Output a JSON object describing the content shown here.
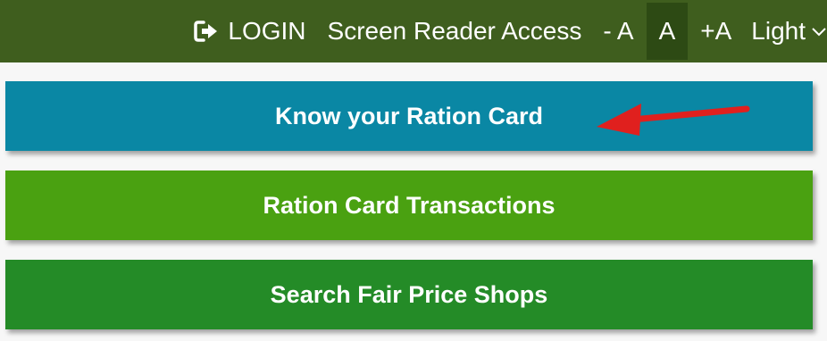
{
  "topbar": {
    "login_icon": "sign-in-icon",
    "login_label": "LOGIN",
    "screen_reader_label": "Screen Reader Access",
    "font_decrease_label": "- A",
    "font_normal_label": "A",
    "font_increase_label": "+A",
    "theme_selected": "Light",
    "theme_icon": "chevron-down-icon",
    "background_color": "#3f5e1e",
    "active_button_color": "#2d4a14"
  },
  "actions": {
    "know_ration_card": "Know your Ration Card",
    "ration_card_transactions": "Ration Card Transactions",
    "search_fair_price_shops": "Search Fair Price Shops"
  },
  "colors": {
    "know_bar": "#0a87a4",
    "transactions_bar": "#4aa111",
    "search_bar": "#248b27",
    "annotation_arrow": "#e0201e"
  },
  "annotation": {
    "icon": "red-arrow-icon"
  }
}
